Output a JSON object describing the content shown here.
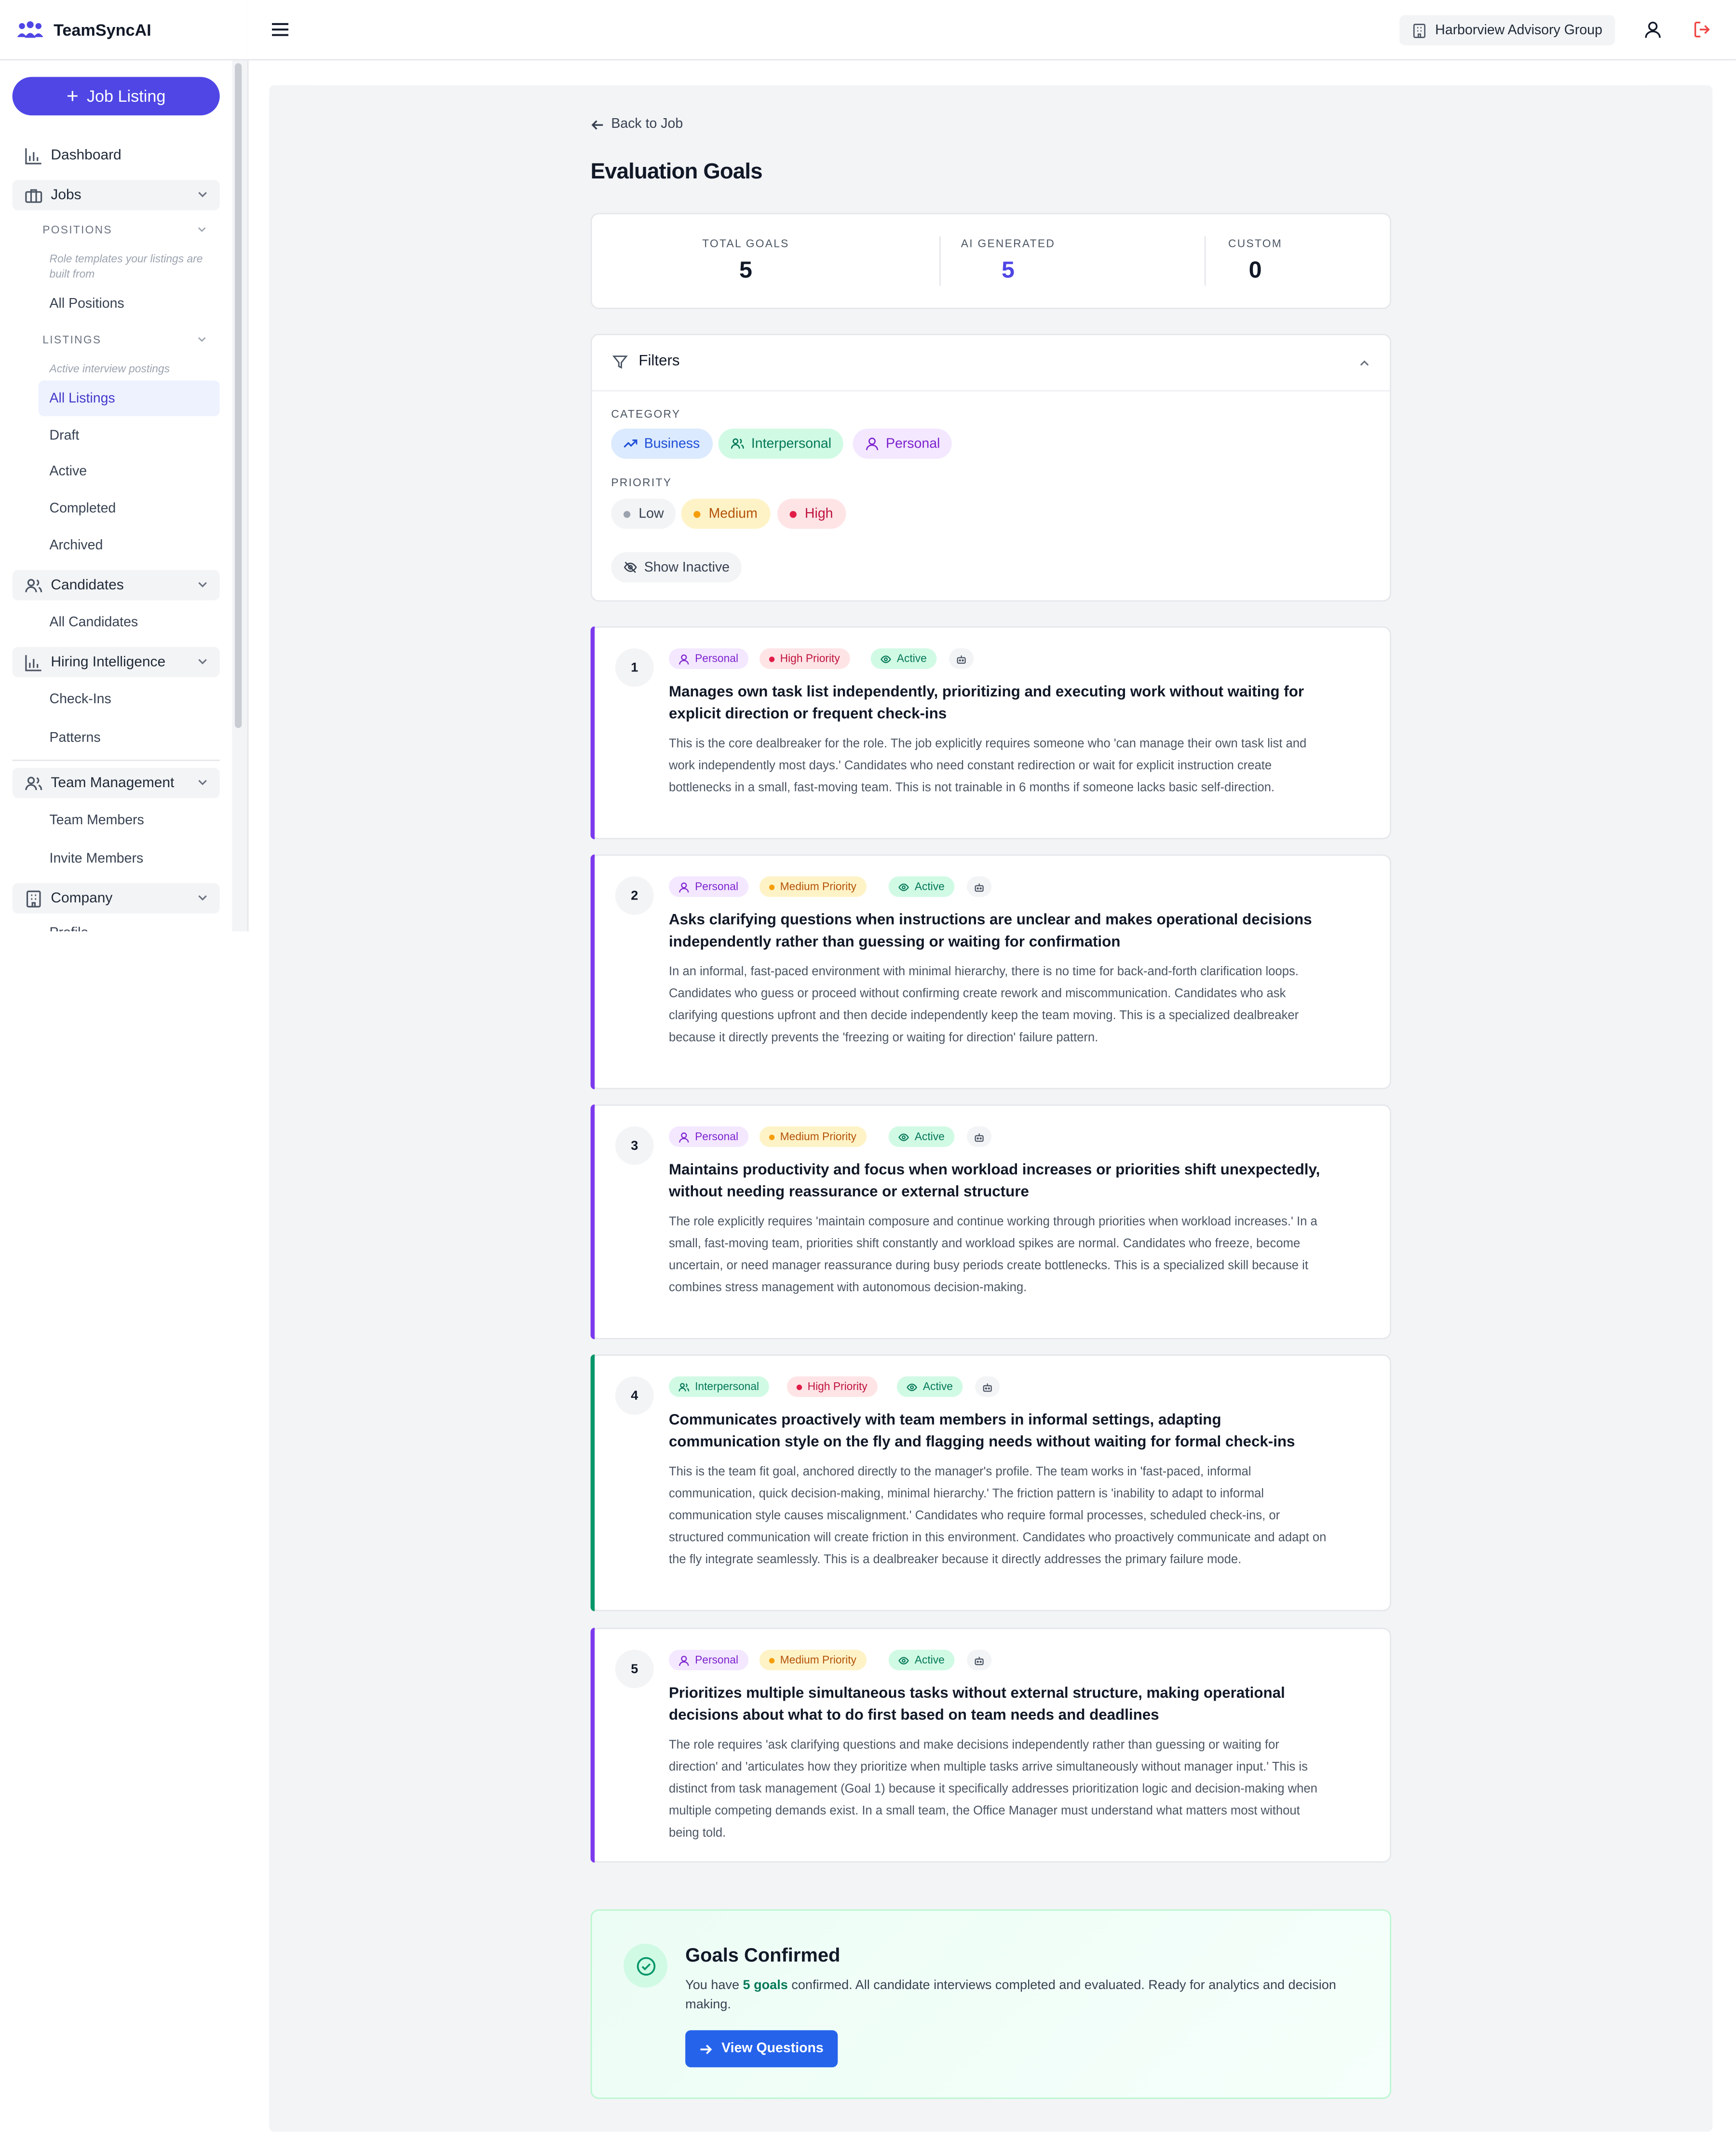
{
  "app": {
    "name": "TeamSyncAI"
  },
  "sidebar": {
    "primary_button": "Job Listing",
    "dashboard": "Dashboard",
    "jobs": "Jobs",
    "positions_head": "POSITIONS",
    "positions_note": "Role templates your listings are built from",
    "all_positions": "All Positions",
    "listings_head": "LISTINGS",
    "listings_note": "Active interview postings",
    "all_listings": "All Listings",
    "draft": "Draft",
    "active": "Active",
    "completed": "Completed",
    "archived": "Archived",
    "candidates": "Candidates",
    "all_candidates": "All Candidates",
    "hiring_intel": "Hiring Intelligence",
    "checkins": "Check-Ins",
    "patterns": "Patterns",
    "team_mgmt": "Team Management",
    "team_members": "Team Members",
    "invite_members": "Invite Members",
    "company": "Company",
    "profile": "Profile"
  },
  "header": {
    "org_name": "Harborview Advisory Group"
  },
  "page": {
    "back_label": "Back to Job",
    "title": "Evaluation Goals"
  },
  "stats": [
    {
      "label": "TOTAL GOALS",
      "value": "5"
    },
    {
      "label": "AI GENERATED",
      "value": "5"
    },
    {
      "label": "CUSTOM",
      "value": "0"
    }
  ],
  "filters": {
    "title": "Filters",
    "category_label": "CATEGORY",
    "categories": [
      "Business",
      "Interpersonal",
      "Personal"
    ],
    "priority_label": "PRIORITY",
    "priorities": [
      "Low",
      "Medium",
      "High"
    ],
    "show_inactive": "Show Inactive"
  },
  "goals": [
    {
      "number": "1",
      "category": "Personal",
      "priority": "High Priority",
      "status": "Active",
      "title": "Manages own task list independently, prioritizing and executing work without waiting for explicit direction or frequent check-ins",
      "description": "This is the core dealbreaker for the role. The job explicitly requires someone who 'can manage their own task list and work independently most days.' Candidates who need constant redirection or wait for explicit instruction create bottlenecks in a small, fast-moving team. This is not trainable in 6 months if someone lacks basic self-direction."
    },
    {
      "number": "2",
      "category": "Personal",
      "priority": "Medium Priority",
      "status": "Active",
      "title": "Asks clarifying questions when instructions are unclear and makes operational decisions independently rather than guessing or waiting for confirmation",
      "description": "In an informal, fast-paced environment with minimal hierarchy, there is no time for back-and-forth clarification loops. Candidates who guess or proceed without confirming create rework and miscommunication. Candidates who ask clarifying questions upfront and then decide independently keep the team moving. This is a specialized dealbreaker because it directly prevents the 'freezing or waiting for direction' failure pattern."
    },
    {
      "number": "3",
      "category": "Personal",
      "priority": "Medium Priority",
      "status": "Active",
      "title": "Maintains productivity and focus when workload increases or priorities shift unexpectedly, without needing reassurance or external structure",
      "description": "The role explicitly requires 'maintain composure and continue working through priorities when workload increases.' In a small, fast-moving team, priorities shift constantly and workload spikes are normal. Candidates who freeze, become uncertain, or need manager reassurance during busy periods create bottlenecks. This is a specialized skill because it combines stress management with autonomous decision-making."
    },
    {
      "number": "4",
      "category": "Interpersonal",
      "priority": "High Priority",
      "status": "Active",
      "title": "Communicates proactively with team members in informal settings, adapting communication style on the fly and flagging needs without waiting for formal check-ins",
      "description": "This is the team fit goal, anchored directly to the manager's profile. The team works in 'fast-paced, informal communication, quick decision-making, minimal hierarchy.' The friction pattern is 'inability to adapt to informal communication style causes miscalignment.' Candidates who require formal processes, scheduled check-ins, or structured communication will create friction in this environment. Candidates who proactively communicate and adapt on the fly integrate seamlessly. This is a dealbreaker because it directly addresses the primary failure mode."
    },
    {
      "number": "5",
      "category": "Personal",
      "priority": "Medium Priority",
      "status": "Active",
      "title": "Prioritizes multiple simultaneous tasks without external structure, making operational decisions about what to do first based on team needs and deadlines",
      "description": "The role requires 'ask clarifying questions and make decisions independently rather than guessing or waiting for direction' and 'articulates how they prioritize when multiple tasks arrive simultaneously without manager input.' This is distinct from task management (Goal 1) because it specifically addresses prioritization logic and decision-making when multiple competing demands exist. In a small team, the Office Manager must understand what matters most without being told."
    }
  ],
  "confirm": {
    "title": "Goals Confirmed",
    "text_pre": "You have",
    "text_count": "5 goals",
    "text_post": "confirmed. All candidate interviews completed and evaluated. Ready for analytics and decision making.",
    "button": "View Questions"
  },
  "colors": {
    "brand": "#4f46e5",
    "personal_accent": "#7c3aed",
    "interpersonal_accent": "#059669",
    "button_blue": "#2563eb"
  }
}
